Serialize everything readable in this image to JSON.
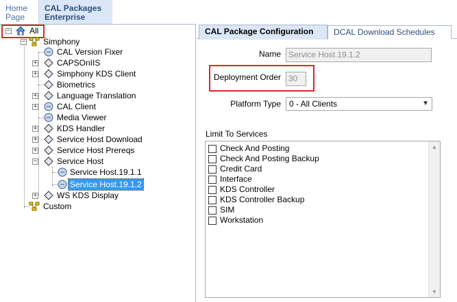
{
  "top_tabs": {
    "home": [
      "Home",
      "Page"
    ],
    "cal_packages": [
      "CAL Packages",
      "Enterprise"
    ]
  },
  "tree": {
    "root": "All",
    "simphony": "Simphony",
    "children": [
      "CAL Version Fixer",
      "CAPSOnIIS",
      "Simphony KDS Client",
      "Biometrics",
      "Language Translation",
      "CAL Client",
      "Media Viewer",
      "KDS Handler",
      "Service Host Download",
      "Service Host Prereqs",
      "Service Host"
    ],
    "service_host_children": [
      "Service Host.19.1.1",
      "Service Host.19.1.2"
    ],
    "ws_kds_display": "WS KDS Display",
    "custom": "Custom"
  },
  "right_tabs": {
    "active": "CAL Package Configuration",
    "inactive": "DCAL Download Schedules"
  },
  "form": {
    "name_label": "Name",
    "name_value": "Service Host.19.1.2",
    "deployment_order_label": "Deployment Order",
    "deployment_order_value": "30",
    "platform_type_label": "Platform Type",
    "platform_type_value": "0 - All Clients",
    "limit_label": "Limit To Services"
  },
  "services": [
    "Check And Posting",
    "Check And Posting Backup",
    "Credit Card",
    "Interface",
    "KDS Controller",
    "KDS Controller Backup",
    "SIM",
    "Workstation"
  ],
  "colors": {
    "highlight_red": "#e02424",
    "selection_blue": "#3399ff",
    "tab_blue": "#dbe7f6"
  }
}
